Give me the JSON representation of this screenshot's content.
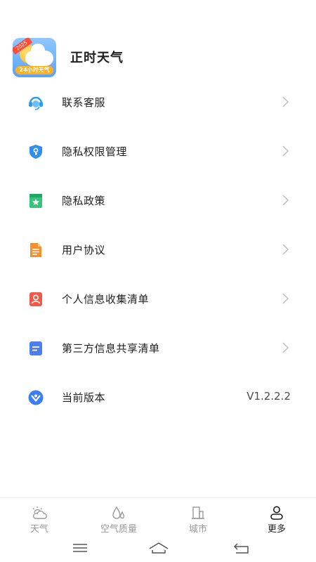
{
  "app": {
    "name": "正时天气",
    "logo_badge": "2025",
    "logo_strip": "24小时天气"
  },
  "menu": {
    "items": [
      {
        "label": "联系客服",
        "icon": "customer-service-icon",
        "color": "#2a9df4"
      },
      {
        "label": "隐私权限管理",
        "icon": "shield-key-icon",
        "color": "#2f8ff0"
      },
      {
        "label": "隐私政策",
        "icon": "star-bookmark-icon",
        "color": "#34c47c"
      },
      {
        "label": "用户协议",
        "icon": "document-icon",
        "color": "#f5902a"
      },
      {
        "label": "个人信息收集清单",
        "icon": "person-card-icon",
        "color": "#f0594a"
      },
      {
        "label": "第三方信息共享清单",
        "icon": "note-icon",
        "color": "#4d7ef0"
      },
      {
        "label": "当前版本",
        "icon": "version-icon",
        "color": "#3d7ff0",
        "value": "V1.2.2.2"
      }
    ]
  },
  "tabbar": {
    "tabs": [
      {
        "label": "天气",
        "icon": "weather-icon",
        "active": false
      },
      {
        "label": "空气质量",
        "icon": "air-quality-icon",
        "active": false
      },
      {
        "label": "城市",
        "icon": "city-icon",
        "active": false
      },
      {
        "label": "更多",
        "icon": "profile-icon",
        "active": true
      }
    ]
  },
  "navbar": {
    "buttons": [
      "menu-nav-icon",
      "home-nav-icon",
      "back-nav-icon"
    ]
  },
  "colors": {
    "chevron": "#c4c4c4",
    "tab_inactive": "#9a9a9a",
    "tab_active": "#1f1f1f"
  }
}
